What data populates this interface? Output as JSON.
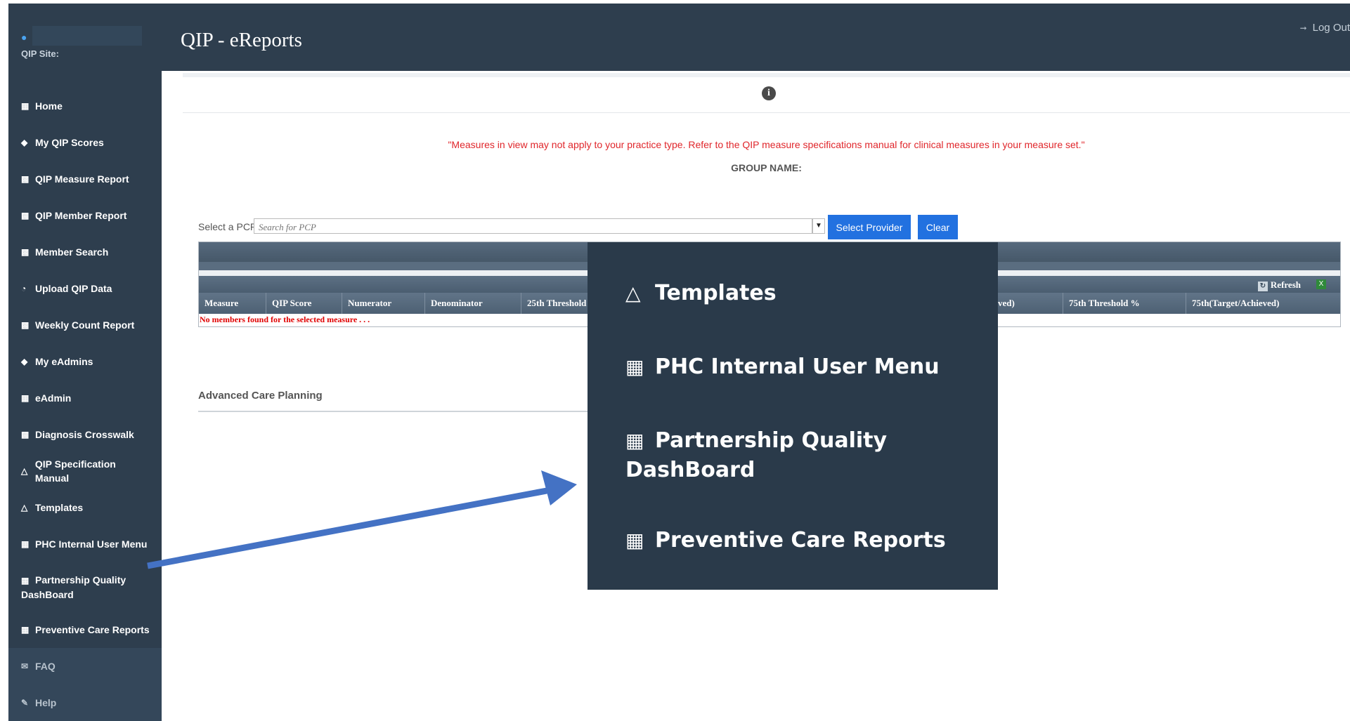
{
  "header": {
    "title": "QIP - eReports",
    "logout_label": "Log Out"
  },
  "sidebar": {
    "site_label": "QIP Site:",
    "items": [
      {
        "label": "Home",
        "icon": "grid-icon"
      },
      {
        "label": "My QIP Scores",
        "icon": "diamond-icon"
      },
      {
        "label": "QIP Measure Report",
        "icon": "bar-chart-icon"
      },
      {
        "label": "QIP Member Report",
        "icon": "bar-chart-icon"
      },
      {
        "label": "Member Search",
        "icon": "bar-chart-icon"
      },
      {
        "label": "Upload QIP Data",
        "icon": "pie-icon"
      },
      {
        "label": "Weekly Count Report",
        "icon": "bar-chart-icon"
      },
      {
        "label": "My eAdmins",
        "icon": "diamond-icon"
      },
      {
        "label": "eAdmin",
        "icon": "grid-icon"
      },
      {
        "label": "Diagnosis Crosswalk",
        "icon": "bar-chart-icon"
      },
      {
        "label": "QIP Specification Manual",
        "icon": "flask-icon"
      },
      {
        "label": "Templates",
        "icon": "flask-icon"
      },
      {
        "label": "PHC Internal User Menu",
        "icon": "grid-icon"
      },
      {
        "label": "Partnership Quality DashBoard",
        "icon": "grid-icon"
      },
      {
        "label": "Preventive Care Reports",
        "icon": "grid-icon"
      },
      {
        "label": "FAQ",
        "icon": "envelope-icon"
      },
      {
        "label": "Help",
        "icon": "edit-icon"
      }
    ]
  },
  "main": {
    "notice": "\"Measures in view may not apply to your practice type. Refer to the QIP measure specifications manual for clinical measures in your measure set.\"",
    "group_name_label": "GROUP NAME:",
    "pcp_label": "Select a PCP",
    "pcp_placeholder": "Search for PCP",
    "select_provider_label": "Select Provider",
    "clear_label": "Clear",
    "refresh_label": "Refresh",
    "columns": [
      "Measure",
      "QIP Score",
      "Numerator",
      "Denominator",
      "25th Threshold",
      "ved)",
      "75th Threshold %",
      "75th(Target/Achieved)"
    ],
    "empty_message": "No members found for the selected measure . . .",
    "section_title": "Advanced Care Planning"
  },
  "callout": {
    "items": [
      {
        "label": "Templates",
        "icon": "flask-icon"
      },
      {
        "label": "PHC Internal User Menu",
        "icon": "grid-icon"
      },
      {
        "label": "Partnership Quality DashBoard",
        "icon": "grid-icon"
      },
      {
        "label": "Preventive Care Reports",
        "icon": "grid-icon"
      }
    ]
  },
  "colors": {
    "sidebar": "#2e3e4e",
    "accent_button": "#2271e0",
    "annotation_arrow": "#4472c4",
    "notice": "#e0262b"
  }
}
